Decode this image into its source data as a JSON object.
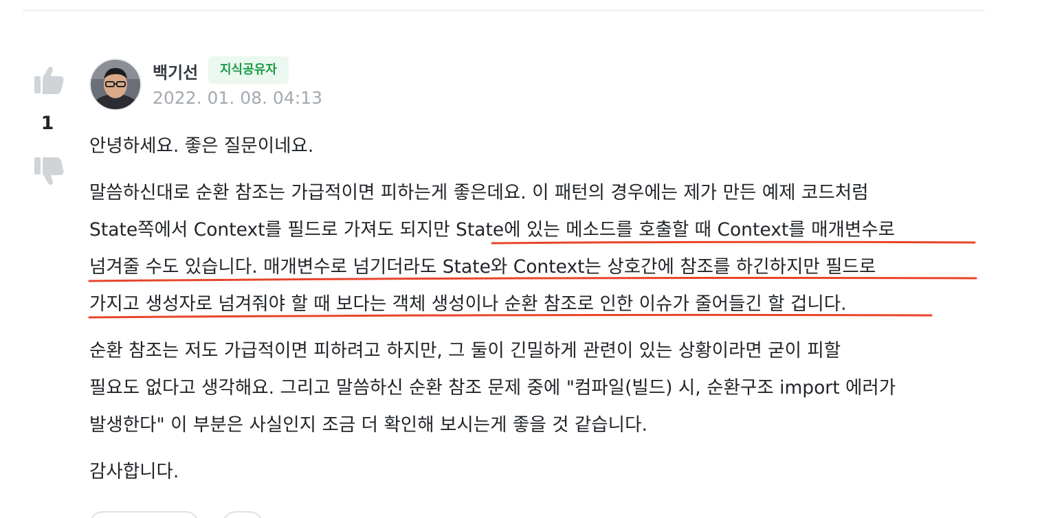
{
  "vote": {
    "count": "1",
    "up_icon": "thumbs-up-icon",
    "down_icon": "thumbs-down-icon"
  },
  "author": {
    "name": "백기선",
    "badge": "지식공유자",
    "timestamp": "2022. 01. 08. 04:13"
  },
  "post": {
    "greeting": "안녕하세요. 좋은 질문이네요.",
    "paragraph2": [
      "말씀하신대로 순환 참조는 가급적이면 피하는게 좋은데요. 이 패턴의 경우에는 제가 만든 예제 코드처럼",
      "State쪽에서 Context를 필드로 가져도 되지만 State에 있는 메소드를 호출할 때 Context를 매개변수로",
      "넘겨줄 수도 있습니다. 매개변수로 넘기더라도 State와 Context는 상호간에 참조를 하긴하지만 필드로",
      "가지고 생성자로 넘겨줘야 할 때 보다는 객체 생성이나 순환 참조로 인한 이슈가 줄어들긴 할 겁니다."
    ],
    "paragraph3": [
      "순환 참조는 저도 가급적이면 피하려고 하지만, 그 둘이 긴밀하게 관련이 있는 상황이라면 굳이 피할",
      "필요도 없다고 생각해요. 그리고 말씀하신 순환 참조 문제 중에 \"컴파일(빌드) 시, 순환구조 import 에러가",
      "발생한다\" 이 부분은 사실인지 조금 더 확인해 보시는게 좋을 것 같습니다."
    ],
    "closing": "감사합니다."
  },
  "colors": {
    "badge_bg": "#ebf8ef",
    "badge_text": "#1a9c45",
    "annotation": "#e8442a",
    "timestamp": "#a3a9af"
  }
}
